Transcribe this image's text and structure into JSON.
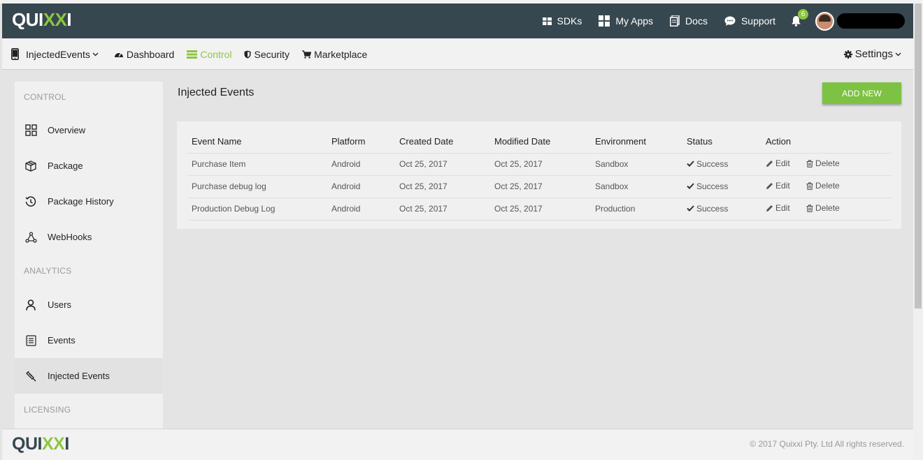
{
  "brand": {
    "prefix": "QUI",
    "x": "XX",
    "suffix": "I"
  },
  "topnav": {
    "sdks": "SDKs",
    "myapps": "My Apps",
    "docs": "Docs",
    "support": "Support",
    "notifications": "6"
  },
  "subnav": {
    "app_selector": "InjectedEvents",
    "dashboard": "Dashboard",
    "control": "Control",
    "security": "Security",
    "marketplace": "Marketplace",
    "settings": "Settings"
  },
  "sidebar": {
    "section_control": "CONTROL",
    "overview": "Overview",
    "package": "Package",
    "package_history": "Package History",
    "webhooks": "WebHooks",
    "section_analytics": "ANALYTICS",
    "users": "Users",
    "events": "Events",
    "injected_events": "Injected Events",
    "section_licensing": "LICENSING"
  },
  "main": {
    "title": "Injected Events",
    "add_new": "ADD NEW",
    "columns": {
      "event_name": "Event Name",
      "platform": "Platform",
      "created": "Created Date",
      "modified": "Modified Date",
      "environment": "Environment",
      "status": "Status",
      "action": "Action"
    },
    "rows": [
      {
        "name": "Purchase Item",
        "platform": "Android",
        "created": "Oct 25, 2017",
        "modified": "Oct 25, 2017",
        "environment": "Sandbox",
        "status": "Success",
        "edit": "Edit",
        "delete": "Delete"
      },
      {
        "name": "Purchase debug log",
        "platform": "Android",
        "created": "Oct 25, 2017",
        "modified": "Oct 25, 2017",
        "environment": "Sandbox",
        "status": "Success",
        "edit": "Edit",
        "delete": "Delete"
      },
      {
        "name": "Production Debug Log",
        "platform": "Android",
        "created": "Oct 25, 2017",
        "modified": "Oct 25, 2017",
        "environment": "Production",
        "status": "Success",
        "edit": "Edit",
        "delete": "Delete"
      }
    ]
  },
  "footer": {
    "copyright": "© 2017 Quixxi Pty. Ltd All rights reserved."
  },
  "colors": {
    "topbar": "#36474f",
    "accent": "#8dc63f",
    "button": "#7dc242"
  },
  "icons": [
    "grid-icon",
    "apps-icon",
    "docs-icon",
    "chat-icon",
    "bell-icon",
    "phone-icon",
    "dashboard-icon",
    "control-icon",
    "shield-icon",
    "cart-icon",
    "gear-icon",
    "overview-icon",
    "package-icon",
    "history-icon",
    "webhooks-icon",
    "user-icon",
    "events-icon",
    "syringe-icon",
    "check-icon",
    "pencil-icon",
    "trash-icon"
  ]
}
